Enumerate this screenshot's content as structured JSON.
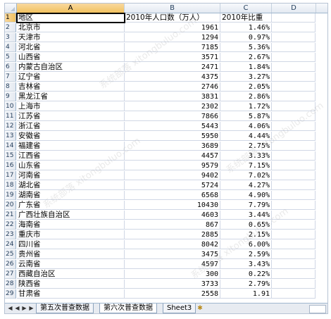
{
  "sheet": {
    "columns": [
      "A",
      "B",
      "C",
      "D"
    ],
    "selected_column": "A",
    "selected_row": "1",
    "header": [
      "地区",
      "2010年人口数（万人）",
      "2010年比重"
    ],
    "rows": [
      [
        "北京市",
        "1961",
        "1.46%"
      ],
      [
        "天津市",
        "1294",
        "0.97%"
      ],
      [
        "河北省",
        "7185",
        "5.36%"
      ],
      [
        "山西省",
        "3571",
        "2.67%"
      ],
      [
        "内蒙古自治区",
        "2471",
        "1.84%"
      ],
      [
        "辽宁省",
        "4375",
        "3.27%"
      ],
      [
        "吉林省",
        "2746",
        "2.05%"
      ],
      [
        "黑龙江省",
        "3831",
        "2.86%"
      ],
      [
        "上海市",
        "2302",
        "1.72%"
      ],
      [
        "江苏省",
        "7866",
        "5.87%"
      ],
      [
        "浙江省",
        "5443",
        "4.06%"
      ],
      [
        "安徽省",
        "5950",
        "4.44%"
      ],
      [
        "福建省",
        "3689",
        "2.75%"
      ],
      [
        "江西省",
        "4457",
        "3.33%"
      ],
      [
        "山东省",
        "9579",
        "7.15%"
      ],
      [
        "河南省",
        "9402",
        "7.02%"
      ],
      [
        "湖北省",
        "5724",
        "4.27%"
      ],
      [
        "湖南省",
        "6568",
        "4.90%"
      ],
      [
        "广东省",
        "10430",
        "7.79%"
      ],
      [
        "广西壮族自治区",
        "4603",
        "3.44%"
      ],
      [
        "海南省",
        "867",
        "0.65%"
      ],
      [
        "重庆市",
        "2885",
        "2.15%"
      ],
      [
        "四川省",
        "8042",
        "6.00%"
      ],
      [
        "贵州省",
        "3475",
        "2.59%"
      ],
      [
        "云南省",
        "4597",
        "3.43%"
      ],
      [
        "西藏自治区",
        "300",
        "0.22%"
      ],
      [
        "陕西省",
        "3733",
        "2.79%"
      ],
      [
        "甘肃省",
        "2558",
        "1.91"
      ]
    ]
  },
  "tabs": [
    "第五次普查数据",
    "第六次普查数据",
    "Sheet3"
  ],
  "active_tab": "第六次普查数据",
  "nav_glyphs": [
    "◀",
    "◀",
    "▶",
    "▶"
  ],
  "new_tab_glyph": "✱",
  "watermark_text": "系统部落 xitongbuluo.com"
}
